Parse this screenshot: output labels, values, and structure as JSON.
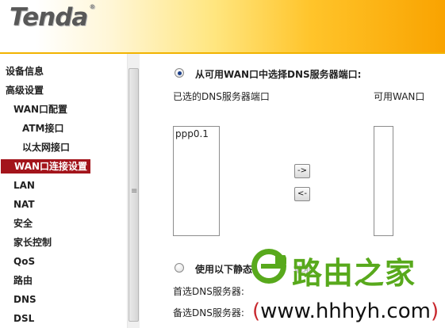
{
  "header": {
    "logo_text": "Tenda",
    "logo_mark": "®"
  },
  "sidebar": {
    "items": [
      {
        "label": "设备信息",
        "level": 0,
        "active": false
      },
      {
        "label": "高级设置",
        "level": 0,
        "active": false
      },
      {
        "label": "WAN口配置",
        "level": 1,
        "active": false
      },
      {
        "label": "ATM接口",
        "level": 2,
        "active": false
      },
      {
        "label": "以太网接口",
        "level": 2,
        "active": false
      },
      {
        "label": "WAN口连接设置",
        "level": 1,
        "active": true
      },
      {
        "label": "LAN",
        "level": 1,
        "active": false
      },
      {
        "label": "NAT",
        "level": 1,
        "active": false
      },
      {
        "label": "安全",
        "level": 1,
        "active": false
      },
      {
        "label": "家长控制",
        "level": 1,
        "active": false
      },
      {
        "label": "QoS",
        "level": 1,
        "active": false
      },
      {
        "label": "路由",
        "level": 1,
        "active": false
      },
      {
        "label": "DNS",
        "level": 1,
        "active": false
      },
      {
        "label": "DSL",
        "level": 1,
        "active": false
      }
    ],
    "scroll_grip": "≡"
  },
  "main": {
    "option_wan_label": "从可用WAN口中选择DNS服务器端口:",
    "selected_header": "已选的DNS服务器端口",
    "available_header": "可用WAN口",
    "selected_ports": [
      "ppp0.1"
    ],
    "available_ports": [],
    "move_right_label": "->",
    "move_left_label": "<-",
    "option_static_label": "使用以下静态",
    "option_static_suffix": "地址:",
    "primary_dns_label": "首选DNS服务器:",
    "secondary_dns_label": "备选DNS服务器:",
    "primary_dns_value": "",
    "secondary_dns_value": ""
  },
  "watermark": {
    "brand_cn": "路由之家",
    "url": "www.hhhyh.com",
    "open_paren": "(",
    "close_paren": ")",
    "green": "#58a91c",
    "red": "#c8282e"
  },
  "colors": {
    "active_nav_bg": "#a3141b",
    "header_orange": "#f9a300"
  }
}
